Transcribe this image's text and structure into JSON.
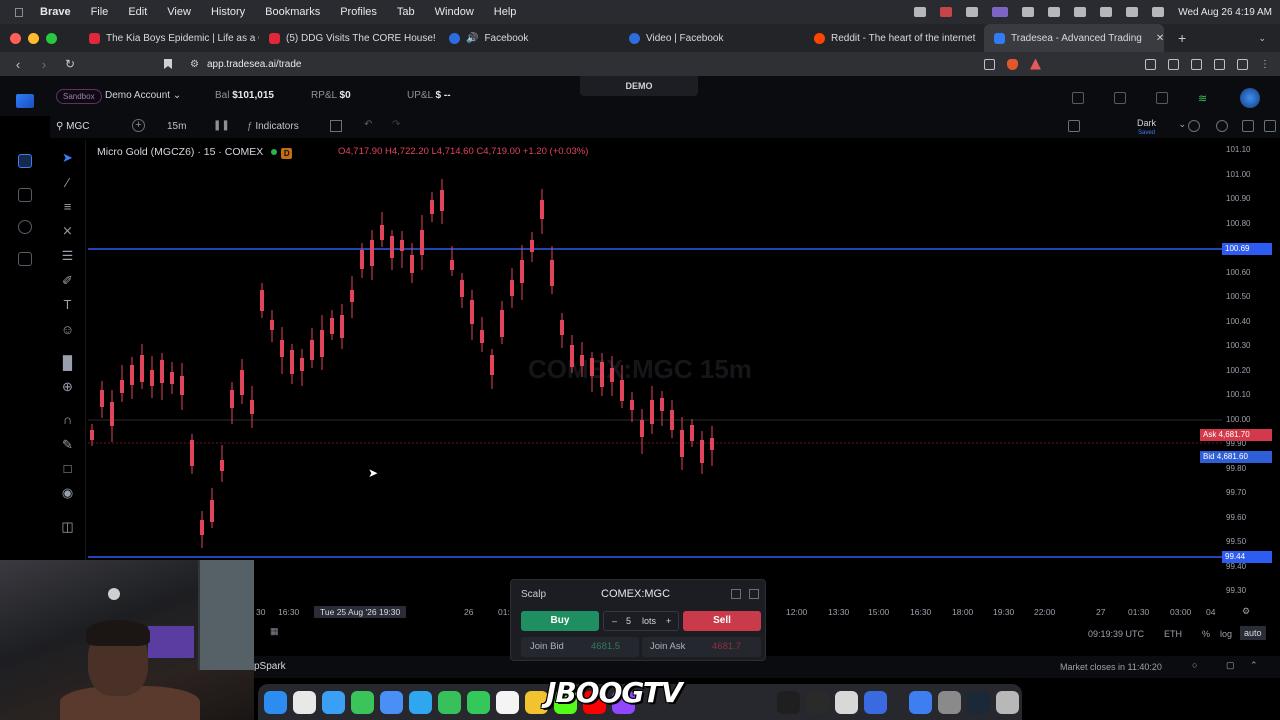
{
  "menubar": {
    "app": "Brave",
    "items": [
      "File",
      "Edit",
      "View",
      "History",
      "Bookmarks",
      "Profiles",
      "Tab",
      "Window",
      "Help"
    ],
    "datetime": "Wed Aug 26  4:19 AM"
  },
  "tabs": [
    {
      "label": "The Kia Boys Epidemic | Life as a C",
      "icon_color": "#e0283a"
    },
    {
      "label": "(5) DDG Visits The CORE House!",
      "icon_color": "#e0283a"
    },
    {
      "label": "Facebook",
      "icon_color": "#2d6de0"
    },
    {
      "label": "Video | Facebook",
      "icon_color": "#2d6de0"
    },
    {
      "label": "Reddit - The heart of the internet",
      "icon_color": "#ff4500"
    },
    {
      "label": "Tradesea - Advanced Trading",
      "icon_color": "#2f7cf6",
      "active": true
    }
  ],
  "address": {
    "url": "app.tradesea.ai/trade"
  },
  "account": {
    "sandbox": "Sandbox",
    "name": "Demo Account",
    "bal_label": "Bal",
    "bal_value": "$101,015",
    "rpl_label": "RP&L",
    "rpl_value": "$0",
    "upl_label": "UP&L",
    "upl_value": "$ --",
    "mode_badge": "DEMO"
  },
  "toolbar": {
    "symbol": "MGC",
    "timeframe": "15m",
    "indicators": "Indicators",
    "theme": "Dark",
    "theme_sub": "Saved"
  },
  "chart": {
    "title": "Micro Gold (MGCZ6) · 15 · COMEX",
    "badge": "D",
    "ohlc": "O4,717.90  H4,722.20  L4,714.60  C4,719.00  +1.20 (+0.03%)",
    "watermark": "COMEX:MGC 15m",
    "price_ticks": [
      "101.10",
      "101.00",
      "100.90",
      "100.80",
      "100.70",
      "100.60",
      "100.50",
      "100.40",
      "100.30",
      "100.20",
      "100.10",
      "100.00",
      "99.90",
      "99.80",
      "99.70",
      "99.60",
      "99.50",
      "99.40",
      "99.30"
    ],
    "line_labels": {
      "upper": "100.69",
      "lower": "99.44"
    },
    "ask": {
      "label": "Ask",
      "value": "4,681.70"
    },
    "bid": {
      "label": "Bid",
      "value": "4,681.60"
    },
    "time_ticks": [
      "30",
      "16:30",
      "26",
      "01:",
      "12:00",
      "13:30",
      "15:00",
      "16:30",
      "18:00",
      "19:30",
      "22:00",
      "27",
      "01:30",
      "03:00",
      "04"
    ],
    "time_cursor": "Tue 25 Aug '26   19:30"
  },
  "status": {
    "clock": "09:19:39 UTC",
    "session": "ETH",
    "pct": "%",
    "log": "log",
    "auto": "auto",
    "market_close": "Market closes in 11:40:20",
    "spark": "pSpark"
  },
  "scalp": {
    "label": "Scalp",
    "symbol": "COMEX:MGC",
    "buy": "Buy",
    "sell": "Sell",
    "qty": "5",
    "qty_unit": "lots",
    "join_bid": "Join Bid",
    "join_bid_price": "4681.5",
    "join_ask": "Join Ask",
    "join_ask_price": "4681.7"
  },
  "overlay": {
    "channel": "JBOOGTV"
  },
  "colors": {
    "bull": "#e0455b",
    "line_blue": "#2f5cf0",
    "ask": "#d23a4b",
    "bid": "#2f5fd6"
  }
}
